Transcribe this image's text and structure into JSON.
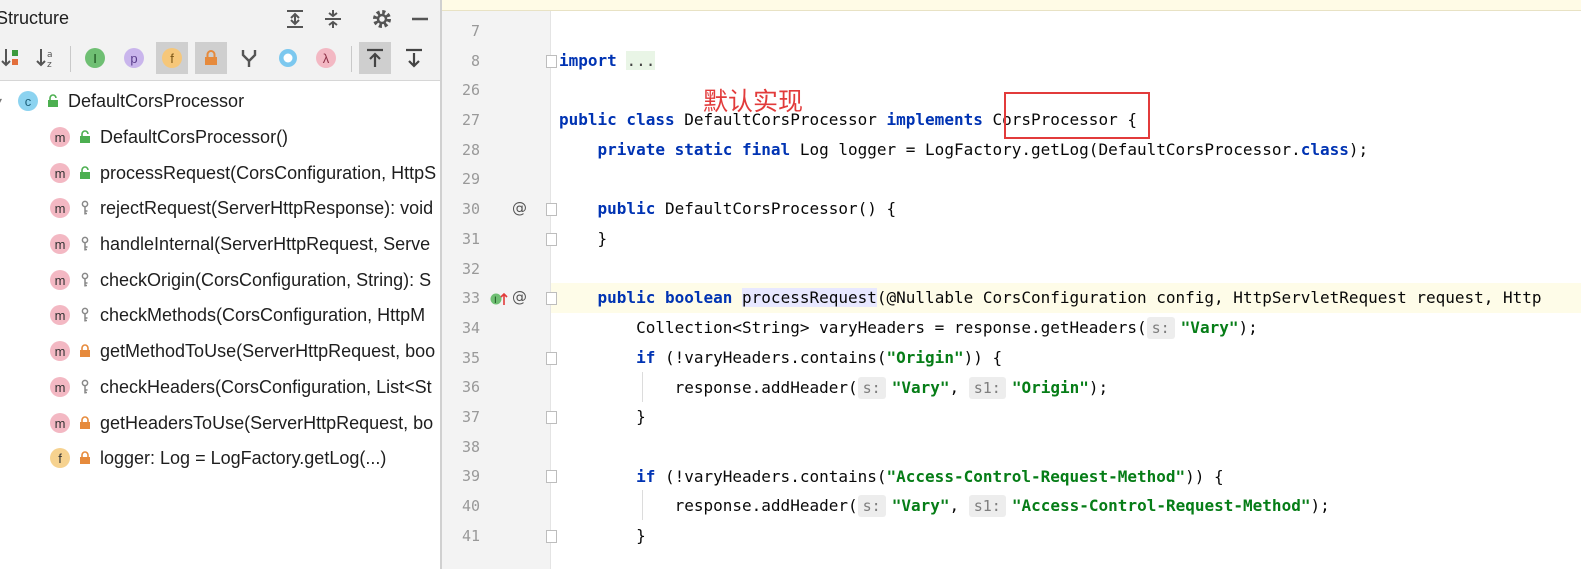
{
  "structure": {
    "title": "Structure",
    "toolbar": {
      "sort_by_type_label": "sort-by-type",
      "sort_alpha_label": "a↓z"
    },
    "tree": [
      {
        "kind": "C",
        "visibility": "public",
        "label": "DefaultCorsProcessor"
      },
      {
        "kind": "m",
        "visibility": "public",
        "label": "DefaultCorsProcessor()"
      },
      {
        "kind": "m",
        "visibility": "public",
        "label": "processRequest(CorsConfiguration, HttpS"
      },
      {
        "kind": "m",
        "visibility": "protected",
        "label": "rejectRequest(ServerHttpResponse): void"
      },
      {
        "kind": "m",
        "visibility": "protected",
        "label": "handleInternal(ServerHttpRequest, Serve"
      },
      {
        "kind": "m",
        "visibility": "protected",
        "label": "checkOrigin(CorsConfiguration, String): S"
      },
      {
        "kind": "m",
        "visibility": "protected",
        "label": "checkMethods(CorsConfiguration, HttpM"
      },
      {
        "kind": "m",
        "visibility": "private",
        "label": "getMethodToUse(ServerHttpRequest, boo"
      },
      {
        "kind": "m",
        "visibility": "protected",
        "label": "checkHeaders(CorsConfiguration, List<St"
      },
      {
        "kind": "m",
        "visibility": "private",
        "label": "getHeadersToUse(ServerHttpRequest, bo"
      },
      {
        "kind": "f",
        "visibility": "private",
        "label": "logger: Log = LogFactory.getLog(...)"
      }
    ]
  },
  "editor": {
    "line_numbers": [
      "7",
      "8",
      "26",
      "27",
      "28",
      "29",
      "30",
      "31",
      "32",
      "33",
      "34",
      "35",
      "36",
      "37",
      "38",
      "39",
      "40",
      "41"
    ],
    "annotation_note": "默认实现",
    "code": {
      "l8_kw": "import",
      "l8_fold": "...",
      "l27_a": "public class",
      "l27_b": " DefaultCorsProcessor ",
      "l27_c": "implements",
      "l27_d": " CorsProcessor {",
      "l28_a": "    private static final",
      "l28_b": " Log logger = LogFactory.getLog(DefaultCorsProcessor.",
      "l28_c": "class",
      "l28_d": ");",
      "l30_a": "    public",
      "l30_b": " DefaultCorsProcessor() {",
      "l31": "    }",
      "l33_a": "    public boolean",
      "l33_b": " ",
      "l33_c": "processRequest",
      "l33_d": "(@Nullable CorsConfiguration config, HttpServletRequest request, Http",
      "l34_a": "        Collection<String> varyHeaders = response.getHeaders(",
      "l34_hint": "s:",
      "l34_s": "\"Vary\"",
      "l34_e": ");",
      "l35_a": "        if",
      "l35_b": " (!varyHeaders.contains(",
      "l35_s": "\"Origin\"",
      "l35_e": ")) {",
      "l36_a": "            response.addHeader(",
      "l36_h1": "s:",
      "l36_s1": "\"Vary\"",
      "l36_m": ", ",
      "l36_h2": "s1:",
      "l36_s2": "\"Origin\"",
      "l36_e": ");",
      "l37": "        }",
      "l39_a": "        if",
      "l39_b": " (!varyHeaders.contains(",
      "l39_s": "\"Access-Control-Request-Method\"",
      "l39_e": ")) {",
      "l40_a": "            response.addHeader(",
      "l40_h1": "s:",
      "l40_s1": "\"Vary\"",
      "l40_m": ", ",
      "l40_h2": "s1:",
      "l40_s2": "\"Access-Control-Request-Method\"",
      "l40_e": ");",
      "l41": "        }"
    },
    "gutter_marks": {
      "at": "@"
    }
  },
  "colors": {
    "keyword": "#0033b3",
    "string": "#067d17",
    "annotation_red": "#e23b3b"
  }
}
